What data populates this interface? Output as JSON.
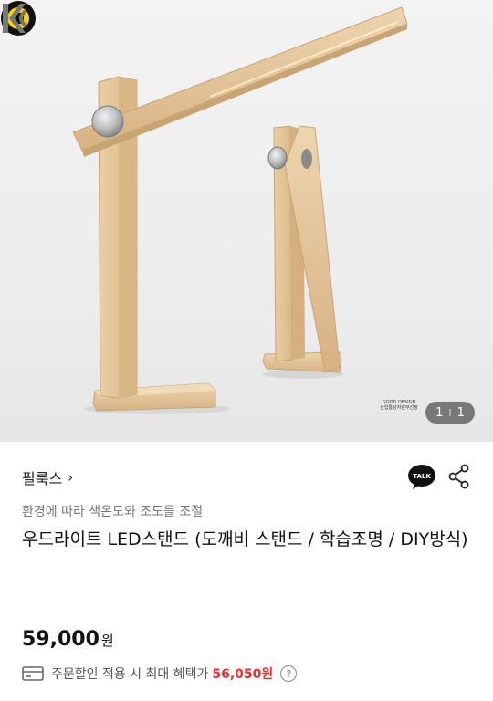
{
  "gallery": {
    "counter_current": "1",
    "counter_separator": "I",
    "counter_total": "1",
    "badge_text": "GOOD DESIGN",
    "badge_sub": "산업통상자원부선정"
  },
  "brand": {
    "name": "필룩스",
    "chevron": "›"
  },
  "product": {
    "subtitle": "환경에 따라 색온도와 조도를 조절",
    "title": "우드라이트 LED스탠드 (도깨비 스탠드 / 학습조명 / DIY방식)",
    "price": "59,000",
    "price_unit": "원"
  },
  "benefit": {
    "text": "주문할인 적용 시 최대 혜택가",
    "amount": "56,050원",
    "help": "?"
  },
  "icons": {
    "talk": "kakao-talk-icon",
    "share": "share-icon",
    "card": "card-icon"
  },
  "colors": {
    "accent_red": "#e8312f",
    "wood": "#e6c79c"
  }
}
